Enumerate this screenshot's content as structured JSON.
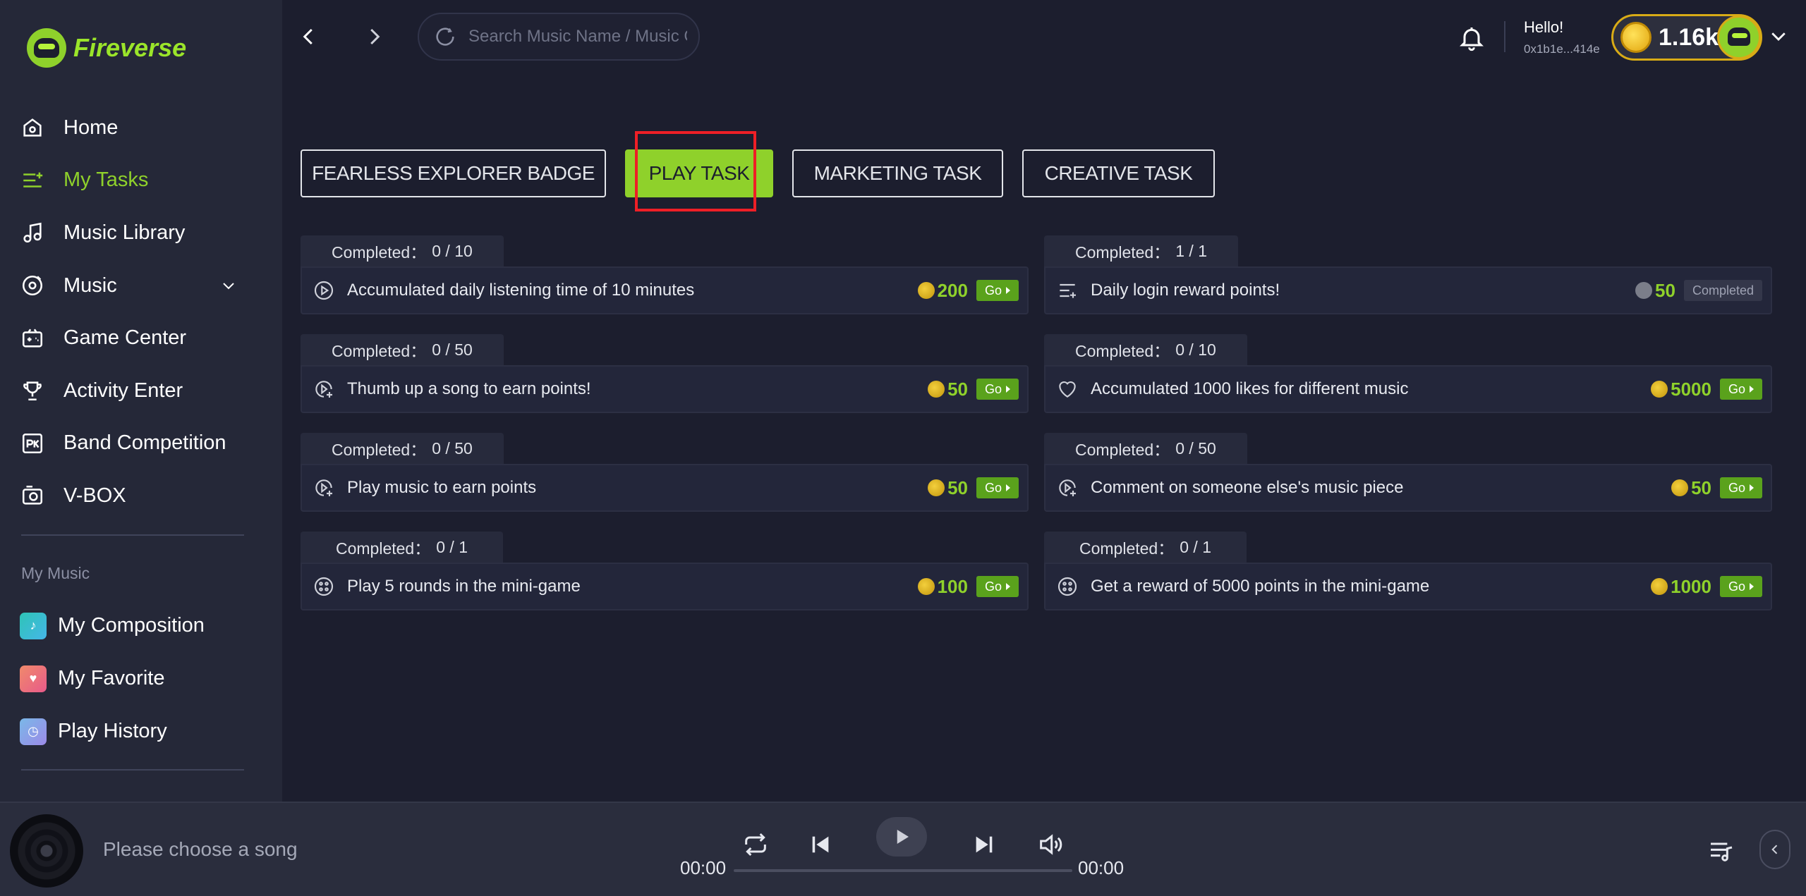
{
  "app": {
    "name": "Fireverse"
  },
  "sidebar": {
    "nav": [
      {
        "label": "Home",
        "icon": "home-icon"
      },
      {
        "label": "My Tasks",
        "icon": "tasks-icon",
        "active": true
      },
      {
        "label": "Music Library",
        "icon": "music-note-icon"
      },
      {
        "label": "Music",
        "icon": "music-disc-icon",
        "expandable": true
      },
      {
        "label": "Game Center",
        "icon": "gamepad-icon"
      },
      {
        "label": "Activity Enter",
        "icon": "trophy-icon"
      },
      {
        "label": "Band Competition",
        "icon": "pk-icon"
      },
      {
        "label": "V-BOX",
        "icon": "vbox-icon"
      }
    ],
    "section_label": "My Music",
    "my_music": [
      {
        "label": "My Composition",
        "icon": "composition-icon",
        "color": "#2ec4b6"
      },
      {
        "label": "My Favorite",
        "icon": "heart-icon",
        "color": "#f06b6b"
      },
      {
        "label": "Play History",
        "icon": "history-icon",
        "color": "#7aa6e8"
      }
    ]
  },
  "topbar": {
    "search_placeholder": "Search Music Name / Music Genre",
    "greeting": "Hello!",
    "wallet": "0x1b1e...414e",
    "coins": "1.16k"
  },
  "tabs": [
    {
      "label": "FEARLESS EXPLORER BADGE"
    },
    {
      "label": "PLAY TASK",
      "active": true
    },
    {
      "label": "MARKETING TASK"
    },
    {
      "label": "CREATIVE TASK"
    }
  ],
  "completed_label": "Completed：",
  "tasks": [
    {
      "progress": "0 / 10",
      "title": "Accumulated daily listening time of 10 minutes",
      "reward": "200",
      "action": "Go",
      "icon": "play-circle-icon"
    },
    {
      "progress": "1 / 1",
      "title": "Daily login reward points!",
      "reward": "50",
      "action": "Completed",
      "icon": "list-add-icon",
      "done": true
    },
    {
      "progress": "0 / 50",
      "title": "Thumb up a song to earn points!",
      "reward": "50",
      "action": "Go",
      "icon": "play-plus-icon"
    },
    {
      "progress": "0 / 10",
      "title": "Accumulated 1000 likes for different music",
      "reward": "5000",
      "action": "Go",
      "icon": "heart-outline-icon"
    },
    {
      "progress": "0 / 50",
      "title": "Play music to earn points",
      "reward": "50",
      "action": "Go",
      "icon": "play-plus-icon"
    },
    {
      "progress": "0 / 50",
      "title": "Comment on someone else's music piece",
      "reward": "50",
      "action": "Go",
      "icon": "play-plus-icon"
    },
    {
      "progress": "0 / 1",
      "title": "Play 5 rounds in the mini-game",
      "reward": "100",
      "action": "Go",
      "icon": "game-icon"
    },
    {
      "progress": "0 / 1",
      "title": "Get a reward of 5000 points in the mini-game",
      "reward": "1000",
      "action": "Go",
      "icon": "game-icon"
    }
  ],
  "player": {
    "now_playing": "Please choose a song",
    "current_time": "00:00",
    "total_time": "00:00",
    "progress": 0
  },
  "colors": {
    "accent": "#8fd12b",
    "highlight": "#ee1f26",
    "coin": "#d8ab16"
  }
}
